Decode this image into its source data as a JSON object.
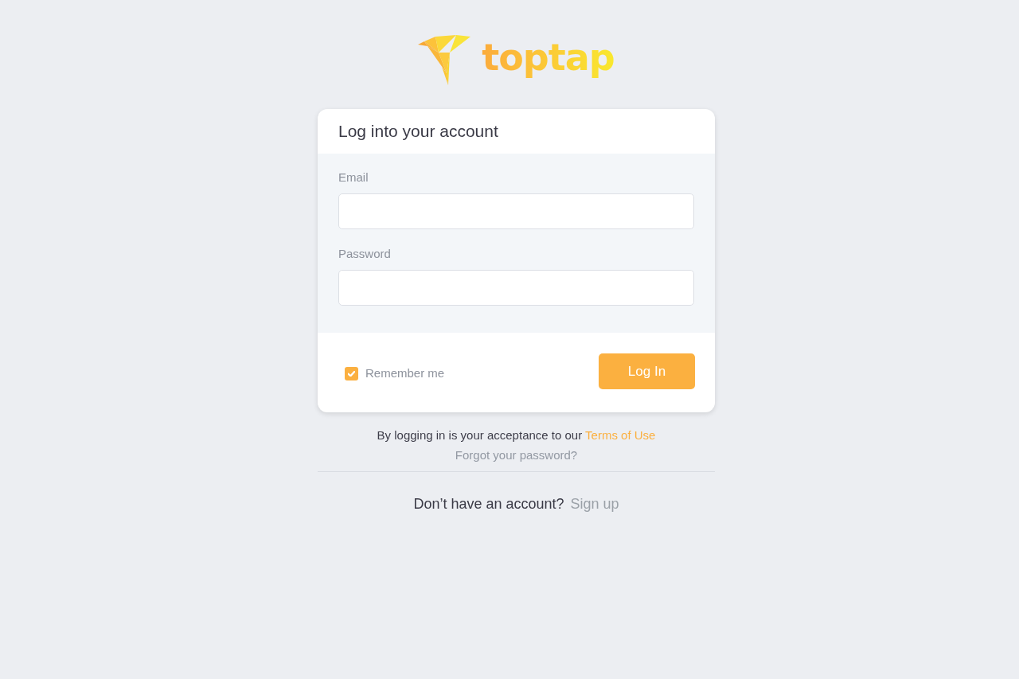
{
  "logo": {
    "wordmark": "toptap"
  },
  "card": {
    "title": "Log into your account",
    "fields": [
      {
        "label": "Email"
      },
      {
        "label": "Password"
      }
    ],
    "remember": {
      "label": "Remember me",
      "checked": true
    },
    "submit": "Log In"
  },
  "terms": {
    "text": "By logging in is your acceptance to our",
    "link": "Terms of Use"
  },
  "forgot": "Forgot your password?",
  "signup": {
    "text": "Don’t have an account?",
    "link": "Sign up"
  }
}
